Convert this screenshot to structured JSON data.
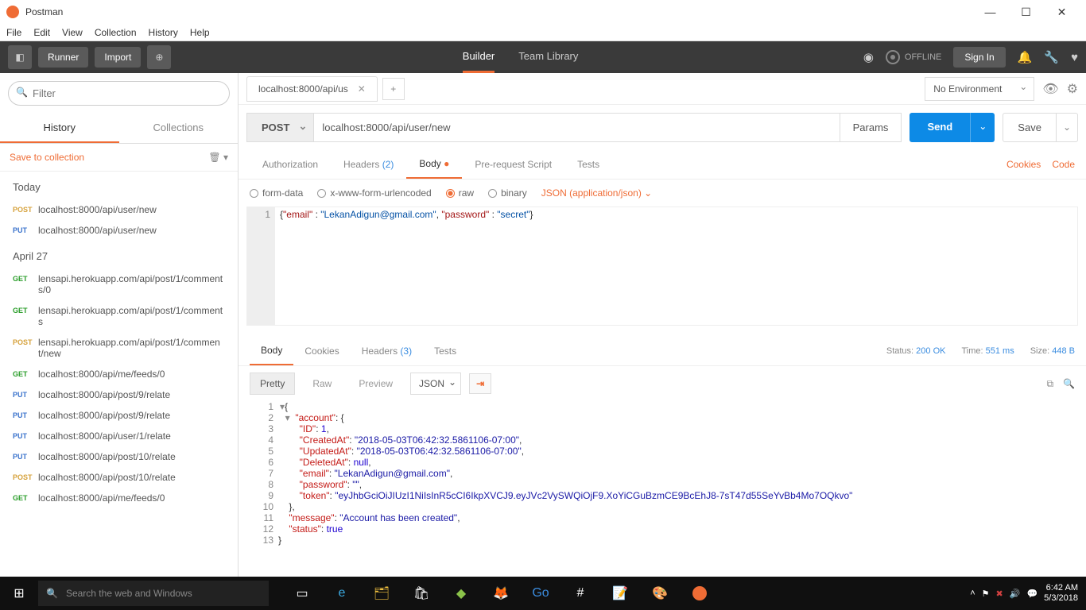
{
  "window": {
    "title": "Postman"
  },
  "menubar": [
    "File",
    "Edit",
    "View",
    "Collection",
    "History",
    "Help"
  ],
  "toolbar": {
    "runner": "Runner",
    "import": "Import",
    "tabs": {
      "builder": "Builder",
      "team": "Team Library"
    },
    "offline": "OFFLINE",
    "signin": "Sign In"
  },
  "sidebar": {
    "filter_placeholder": "Filter",
    "history_tab": "History",
    "collections_tab": "Collections",
    "save_to_collection": "Save to collection",
    "sections": [
      {
        "label": "Today",
        "items": [
          {
            "method": "POST",
            "url": "localhost:8000/api/user/new"
          },
          {
            "method": "PUT",
            "url": "localhost:8000/api/user/new"
          }
        ]
      },
      {
        "label": "April 27",
        "items": [
          {
            "method": "GET",
            "url": "lensapi.herokuapp.com/api/post/1/comments/0"
          },
          {
            "method": "GET",
            "url": "lensapi.herokuapp.com/api/post/1/comments"
          },
          {
            "method": "POST",
            "url": "lensapi.herokuapp.com/api/post/1/comment/new"
          },
          {
            "method": "GET",
            "url": "localhost:8000/api/me/feeds/0"
          },
          {
            "method": "PUT",
            "url": "localhost:8000/api/post/9/relate"
          },
          {
            "method": "PUT",
            "url": "localhost:8000/api/post/9/relate"
          },
          {
            "method": "PUT",
            "url": "localhost:8000/api/user/1/relate"
          },
          {
            "method": "PUT",
            "url": "localhost:8000/api/post/10/relate"
          },
          {
            "method": "POST",
            "url": "localhost:8000/api/post/10/relate"
          },
          {
            "method": "GET",
            "url": "localhost:8000/api/me/feeds/0"
          }
        ]
      }
    ]
  },
  "request": {
    "tab_label": "localhost:8000/api/us",
    "env": "No Environment",
    "method": "POST",
    "url": "localhost:8000/api/user/new",
    "params": "Params",
    "send": "Send",
    "save": "Save",
    "tabs": {
      "auth": "Authorization",
      "headers": "Headers",
      "headers_count": "(2)",
      "body": "Body",
      "prereq": "Pre-request Script",
      "tests": "Tests"
    },
    "links": {
      "cookies": "Cookies",
      "code": "Code"
    },
    "body_opts": {
      "formdata": "form-data",
      "urlencoded": "x-www-form-urlencoded",
      "raw": "raw",
      "binary": "binary",
      "json_sel": "JSON (application/json)"
    },
    "body_line": "1",
    "body_json": {
      "email_key": "\"email\"",
      "email_val": "\"LekanAdigun@gmail.com\"",
      "pwd_key": "\"password\"",
      "pwd_val": "\"secret\""
    }
  },
  "response": {
    "tabs": {
      "body": "Body",
      "cookies": "Cookies",
      "headers": "Headers",
      "headers_count": "(3)",
      "tests": "Tests"
    },
    "status_label": "Status:",
    "status_val": "200 OK",
    "time_label": "Time:",
    "time_val": "551 ms",
    "size_label": "Size:",
    "size_val": "448 B",
    "views": {
      "pretty": "Pretty",
      "raw": "Raw",
      "preview": "Preview",
      "format": "JSON"
    },
    "json": {
      "account_key": "\"account\"",
      "id_key": "\"ID\"",
      "id_val": "1",
      "created_key": "\"CreatedAt\"",
      "created_val": "\"2018-05-03T06:42:32.5861106-07:00\"",
      "updated_key": "\"UpdatedAt\"",
      "updated_val": "\"2018-05-03T06:42:32.5861106-07:00\"",
      "deleted_key": "\"DeletedAt\"",
      "deleted_val": "null",
      "email_key": "\"email\"",
      "email_val": "\"LekanAdigun@gmail.com\"",
      "pwd_key": "\"password\"",
      "pwd_val": "\"\"",
      "token_key": "\"token\"",
      "token_val": "\"eyJhbGciOiJIUzI1NiIsInR5cCI6IkpXVCJ9.eyJVc2VySWQiOjF9.XoYiCGuBzmCE9BcEhJ8-7sT47d55SeYvBb4Mo7OQkvo\"",
      "msg_key": "\"message\"",
      "msg_val": "\"Account has been created\"",
      "status_key": "\"status\"",
      "status_val": "true"
    }
  },
  "taskbar": {
    "search": "Search the web and Windows",
    "time": "6:42 AM",
    "date": "5/3/2018"
  }
}
